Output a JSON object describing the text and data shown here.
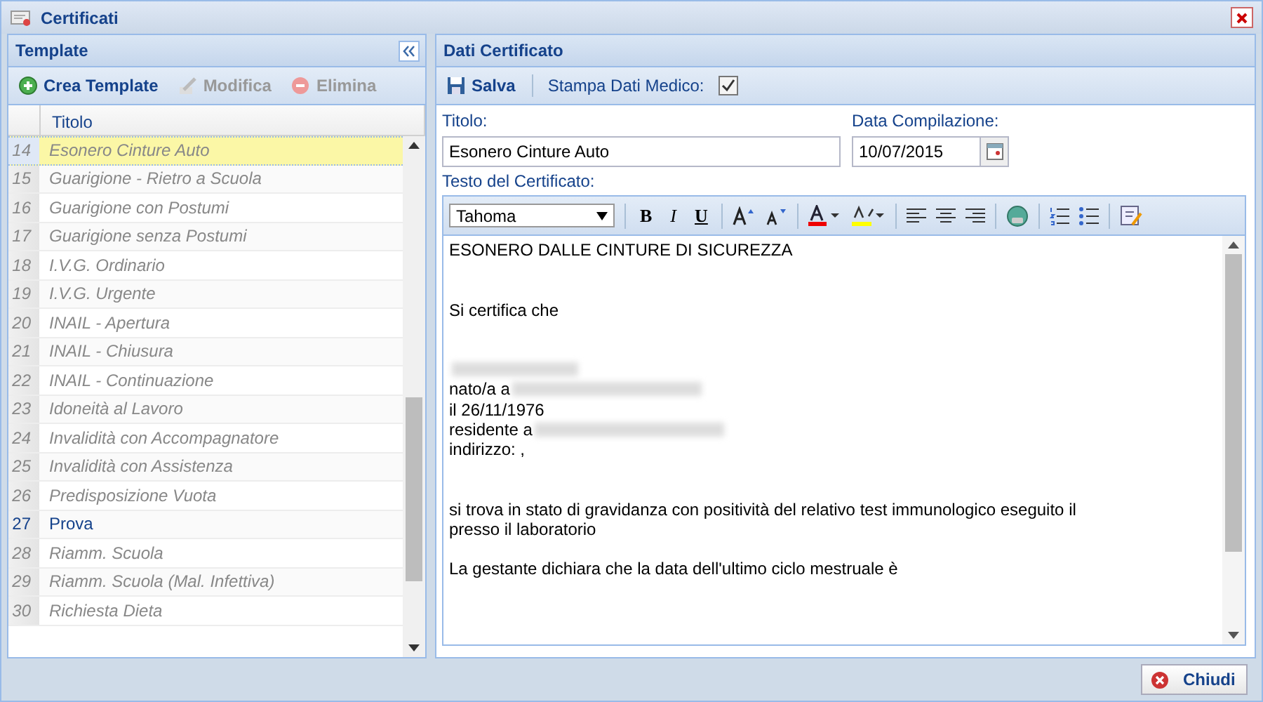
{
  "window": {
    "title": "Certificati"
  },
  "template_panel": {
    "title": "Template",
    "toolbar": [
      {
        "kind": "add",
        "label": "Crea Template",
        "disabled": false
      },
      {
        "kind": "edit",
        "label": "Modifica",
        "disabled": true
      },
      {
        "kind": "delete",
        "label": "Elimina",
        "disabled": true
      }
    ],
    "column": "Titolo",
    "rows": [
      {
        "number": "14",
        "title": "Esonero Cinture Auto",
        "disabled": true,
        "selected": true
      },
      {
        "number": "15",
        "title": "Guarigione - Rietro a Scuola",
        "disabled": true,
        "selected": false
      },
      {
        "number": "16",
        "title": "Guarigione con Postumi",
        "disabled": true,
        "selected": false
      },
      {
        "number": "17",
        "title": "Guarigione senza Postumi",
        "disabled": true,
        "selected": false
      },
      {
        "number": "18",
        "title": "I.V.G. Ordinario",
        "disabled": true,
        "selected": false
      },
      {
        "number": "19",
        "title": "I.V.G. Urgente",
        "disabled": true,
        "selected": false
      },
      {
        "number": "20",
        "title": "INAIL - Apertura",
        "disabled": true,
        "selected": false
      },
      {
        "number": "21",
        "title": "INAIL - Chiusura",
        "disabled": true,
        "selected": false
      },
      {
        "number": "22",
        "title": "INAIL - Continuazione",
        "disabled": true,
        "selected": false
      },
      {
        "number": "23",
        "title": "Idoneità al Lavoro",
        "disabled": true,
        "selected": false
      },
      {
        "number": "24",
        "title": "Invalidità con Accompagnatore",
        "disabled": true,
        "selected": false
      },
      {
        "number": "25",
        "title": "Invalidità con Assistenza",
        "disabled": true,
        "selected": false
      },
      {
        "number": "26",
        "title": "Predisposizione Vuota",
        "disabled": true,
        "selected": false
      },
      {
        "number": "27",
        "title": "Prova",
        "disabled": false,
        "selected": false
      },
      {
        "number": "28",
        "title": "Riamm. Scuola",
        "disabled": true,
        "selected": false
      },
      {
        "number": "29",
        "title": "Riamm. Scuola (Mal. Infettiva)",
        "disabled": true,
        "selected": false
      },
      {
        "number": "30",
        "title": "Richiesta Dieta",
        "disabled": true,
        "selected": false
      }
    ]
  },
  "certificate_panel": {
    "title": "Dati Certificato",
    "save_button": "Salva",
    "print_doctor_label": "Stampa Dati Medico:",
    "print_doctor_checked": true,
    "title_label": "Titolo:",
    "title_value": "Esonero Cinture Auto",
    "date_label": "Data Compilazione:",
    "date_value": "10/07/2015",
    "text_label": "Testo del Certificato:",
    "font": "Tahoma",
    "format_buttons": [
      {
        "kind": "bold",
        "label": "B"
      },
      {
        "kind": "italic",
        "label": "I"
      },
      {
        "kind": "underline",
        "label": "U"
      }
    ],
    "body": [
      {
        "kind": "text",
        "text": "ESONERO DALLE CINTURE DI SICUREZZA"
      },
      {
        "kind": "blank"
      },
      {
        "kind": "blank"
      },
      {
        "kind": "text",
        "text": "Si certifica che"
      },
      {
        "kind": "blank"
      },
      {
        "kind": "blank"
      },
      {
        "kind": "redacted"
      },
      {
        "kind": "text",
        "text": "nato/a a",
        "redacted_tail": true
      },
      {
        "kind": "text",
        "text": "il 26/11/1976"
      },
      {
        "kind": "text",
        "text": "residente a",
        "redacted_tail": true
      },
      {
        "kind": "text",
        "text": "indirizzo: ,"
      },
      {
        "kind": "blank"
      },
      {
        "kind": "blank"
      },
      {
        "kind": "text",
        "text": "si trova in stato di gravidanza con positività del relativo test immunologico eseguito il"
      },
      {
        "kind": "text",
        "text": "presso il laboratorio"
      },
      {
        "kind": "blank"
      },
      {
        "kind": "text",
        "text": "La gestante dichiara che la data dell'ultimo ciclo mestruale è"
      }
    ]
  },
  "footer": {
    "close_button": "Chiudi"
  }
}
